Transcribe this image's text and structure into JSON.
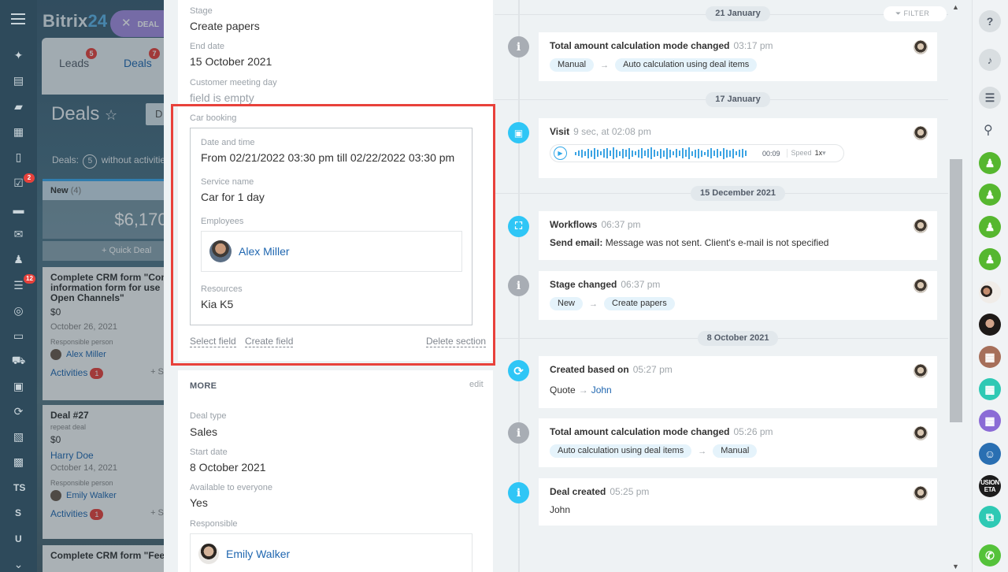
{
  "leftnav": {
    "badges": {
      "tasks": "2",
      "filter": "12"
    },
    "texts": [
      "TS",
      "S",
      "U"
    ]
  },
  "crm": {
    "logo": {
      "main": "Bitrix",
      "num": "24"
    },
    "deal_pill": "DEAL",
    "tabs": [
      {
        "label": "Leads",
        "badge": "5"
      },
      {
        "label": "Deals",
        "badge": "7"
      }
    ],
    "page_title": "Deals",
    "title_btn": "D",
    "deals_count_prefix": "Deals:",
    "deals_count": "5",
    "deals_count_suffix": "without activitie",
    "column": {
      "name": "New",
      "count": "(4)",
      "sum": "$6,170",
      "quick_deal": "+ Quick Deal"
    },
    "cards": [
      {
        "title": "Complete CRM form \"Con information form for use Open Channels\"",
        "sub": "",
        "sum": "$0",
        "date": "October 26, 2021",
        "responsible_label": "Responsible person",
        "person": "Alex Miller",
        "activities": "Activities",
        "activities_count": "1",
        "more": "+ Se"
      },
      {
        "title": "Deal #27",
        "sub": "repeat deal",
        "sum": "$0",
        "contact": "Harry Doe",
        "date": "October 14, 2021",
        "responsible_label": "Responsible person",
        "person": "Emily Walker",
        "activities": "Activities",
        "activities_count": "1",
        "more": "+ Se"
      },
      {
        "title": "Complete CRM form \"Feed"
      }
    ]
  },
  "details": {
    "fields": [
      {
        "label": "Stage",
        "value": "Create papers"
      },
      {
        "label": "End date",
        "value": "15 October 2021"
      },
      {
        "label": "Customer meeting day",
        "value": "field is empty"
      }
    ],
    "car_booking": {
      "label": "Car booking",
      "datetime_label": "Date and time",
      "datetime_value": "From 02/21/2022 03:30 pm till 02/22/2022 03:30 pm",
      "service_label": "Service name",
      "service_value": "Car for 1 day",
      "employees_label": "Employees",
      "employee": "Alex Miller",
      "resources_label": "Resources",
      "resources_value": "Kia K5"
    },
    "links": {
      "select": "Select field",
      "create": "Create field",
      "delete": "Delete section"
    },
    "more": {
      "title": "MORE",
      "edit": "edit",
      "fields": [
        {
          "label": "Deal type",
          "value": "Sales"
        },
        {
          "label": "Start date",
          "value": "8 October 2021"
        },
        {
          "label": "Available to everyone",
          "value": "Yes"
        }
      ],
      "responsible_label": "Responsible",
      "responsible": "Emily Walker"
    }
  },
  "timeline": {
    "filter": "FILTER",
    "dates": [
      "21 January",
      "17 January",
      "15 December 2021",
      "8 October 2021"
    ],
    "events": [
      {
        "title": "Total amount calculation mode changed",
        "time": "03:17 pm",
        "from": "Manual",
        "to": "Auto calculation using deal items"
      },
      {
        "title": "Visit",
        "time": "9 sec, at 02:08 pm",
        "duration": "00:09",
        "speed_label": "Speed",
        "speed": "1x"
      },
      {
        "title": "Workflows",
        "time": "06:37 pm",
        "body_bold": "Send email:",
        "body": "Message was not sent. Client's e-mail is not specified"
      },
      {
        "title": "Stage changed",
        "time": "06:37 pm",
        "from": "New",
        "to": "Create papers"
      },
      {
        "title": "Created based on",
        "time": "05:27 pm",
        "source": "Quote",
        "target": "John"
      },
      {
        "title": "Total amount calculation mode changed",
        "time": "05:26 pm",
        "from": "Auto calculation using deal items",
        "to": "Manual"
      },
      {
        "title": "Deal created",
        "time": "05:25 pm",
        "body": "John"
      }
    ]
  },
  "rightbar": {
    "dark_label_1": "USION",
    "dark_label_2": "ETA"
  }
}
